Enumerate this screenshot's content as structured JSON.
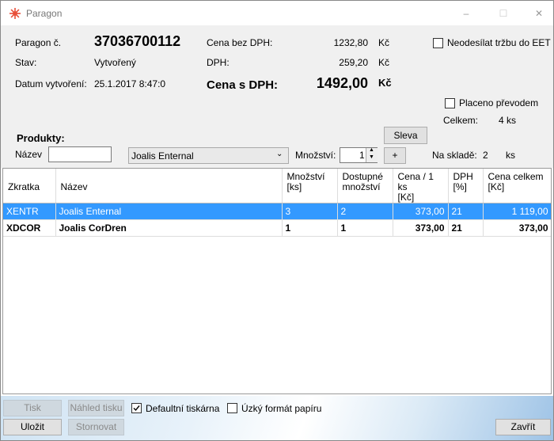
{
  "window": {
    "title": "Paragon",
    "minimize": "–",
    "maximize": "☐",
    "close": "✕"
  },
  "header": {
    "receipt_label": "Paragon č.",
    "receipt_number": "37036700112",
    "state_label": "Stav:",
    "state_value": "Vytvořený",
    "created_label": "Datum vytvoření:",
    "created_value": "25.1.2017 8:47:0",
    "price_no_vat_label": "Cena bez DPH:",
    "price_no_vat_value": "1232,80",
    "price_no_vat_cur": "Kč",
    "vat_label": "DPH:",
    "vat_value": "259,20",
    "vat_cur": "Kč",
    "price_vat_label": "Cena s DPH:",
    "price_vat_value": "1492,00",
    "price_vat_cur": "Kč",
    "eet_label": "Neodesílat tržbu do EET",
    "transfer_label": "Placeno převodem",
    "total_label": "Celkem:",
    "total_value": "4 ks"
  },
  "products": {
    "section_label": "Produkty:",
    "name_label": "Název",
    "name_value": "",
    "product_selected": "Joalis Enternal",
    "qty_label": "Množství:",
    "qty_value": "1",
    "add_label": "+",
    "discount_label": "Sleva",
    "stock_label": "Na skladě:",
    "stock_value": "2",
    "stock_unit": "ks"
  },
  "table": {
    "columns": [
      "Zkratka",
      "Název",
      "Množství\n[ks]",
      "Dostupné\nmnožství",
      "Cena / 1 ks\n[Kč]",
      "DPH\n[%]",
      "Cena celkem\n[Kč]"
    ],
    "rows": [
      [
        "XENTR",
        "Joalis Enternal",
        "3",
        "2",
        "373,00",
        "21",
        "1 119,00"
      ],
      [
        "XDCOR",
        "Joalis CorDren",
        "1",
        "1",
        "373,00",
        "21",
        "373,00"
      ]
    ]
  },
  "footer": {
    "print_label": "Tisk",
    "preview_label": "Náhled tisku",
    "default_printer_label": "Defaultní tiskárna",
    "narrow_paper_label": "Úzký formát papíru",
    "save_label": "Uložit",
    "cancel_label": "Stornovat",
    "close_label": "Zavřít"
  },
  "colors": {
    "selection": "#3399ff",
    "panel": "#f0f0f0",
    "icon": "#e8503a"
  }
}
